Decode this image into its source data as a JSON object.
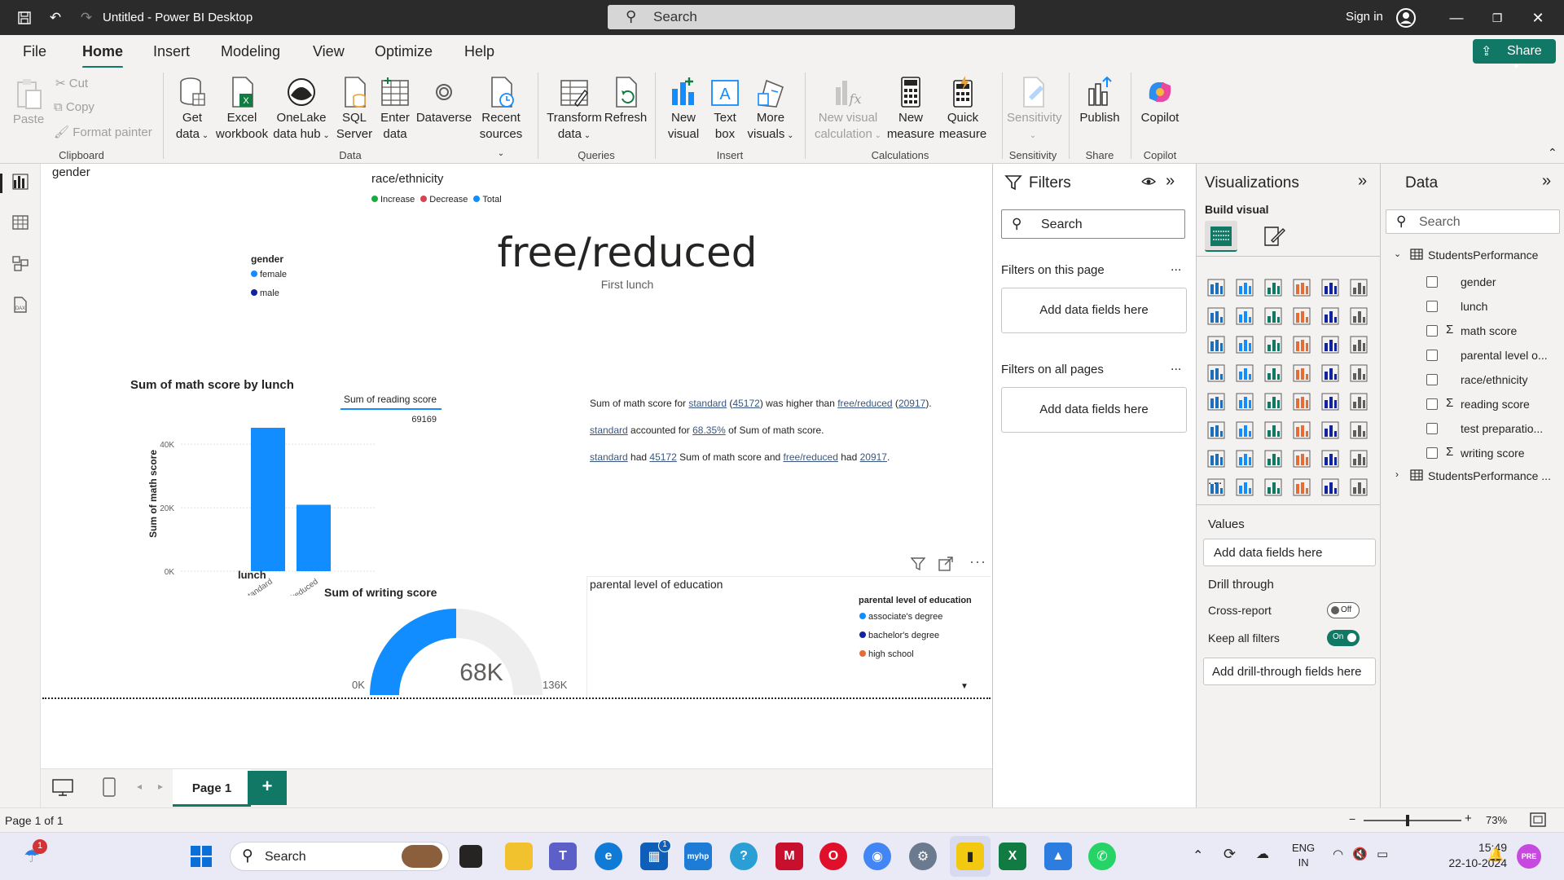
{
  "window": {
    "title": "Untitled - Power BI Desktop",
    "search_placeholder": "Search",
    "sign_in": "Sign in"
  },
  "menu": [
    "File",
    "Home",
    "Insert",
    "Modeling",
    "View",
    "Optimize",
    "Help"
  ],
  "share_label": "Share",
  "ribbon": {
    "clipboard": {
      "paste": "Paste",
      "cut": "Cut",
      "copy": "Copy",
      "format_painter": "Format painter",
      "group": "Clipboard"
    },
    "data": {
      "get_data": [
        "Get",
        "data"
      ],
      "excel": [
        "Excel",
        "workbook"
      ],
      "onelake": [
        "OneLake",
        "data hub"
      ],
      "sql": [
        "SQL",
        "Server"
      ],
      "enter": [
        "Enter",
        "data"
      ],
      "dataverse": [
        "Dataverse",
        ""
      ],
      "recent": [
        "Recent",
        "sources"
      ],
      "group": "Data"
    },
    "queries": {
      "transform": [
        "Transform",
        "data"
      ],
      "refresh": [
        "Refresh",
        ""
      ],
      "group": "Queries"
    },
    "insert": {
      "new_visual": [
        "New",
        "visual"
      ],
      "text_box": [
        "Text",
        "box"
      ],
      "more_visuals": [
        "More",
        "visuals"
      ],
      "group": "Insert"
    },
    "calculations": {
      "new_visual_calc": [
        "New visual",
        "calculation"
      ],
      "new_measure": [
        "New",
        "measure"
      ],
      "quick_measure": [
        "Quick",
        "measure"
      ],
      "group": "Calculations"
    },
    "sensitivity": {
      "label": "Sensitivity",
      "group": "Sensitivity"
    },
    "share": {
      "publish": "Publish",
      "group": "Share"
    },
    "copilot": {
      "label": "Copilot",
      "group": "Copilot"
    }
  },
  "canvas": {
    "gender_title": "gender",
    "race_title": "race/ethnicity",
    "race_legend": [
      {
        "label": "Increase",
        "color": "#1aab40"
      },
      {
        "label": "Decrease",
        "color": "#d64550"
      },
      {
        "label": "Total",
        "color": "#118dff"
      }
    ],
    "gender_legend_title": "gender",
    "gender_legend": [
      {
        "label": "female",
        "color": "#118dff"
      },
      {
        "label": "male",
        "color": "#12239e"
      }
    ],
    "card_value": "free/reduced",
    "card_label": "First lunch",
    "reading_table": {
      "header": "Sum of reading score",
      "value": "69169"
    },
    "narrative": {
      "p1": [
        "Sum of math score for ",
        "standard",
        " (",
        "45172",
        ") was higher than ",
        "free/reduced",
        " (",
        "20917",
        "). "
      ],
      "p2": [
        "standard",
        " accounted for ",
        "68.35%",
        " of Sum of math score."
      ],
      "p3": [
        "standard",
        " had ",
        "45172",
        " Sum of math score and ",
        "free/reduced",
        " had ",
        "20917",
        "."
      ]
    },
    "gauge": {
      "title": "Sum of writing score",
      "value": 68,
      "min": 0,
      "max": 136,
      "value_label": "68K",
      "min_label": "0K",
      "max_label": "136K"
    },
    "pie_title": "parental level of education",
    "pie_legend_title": "parental level of education",
    "pie_legend": [
      {
        "label": "associate's degree",
        "color": "#118dff"
      },
      {
        "label": "bachelor's degree",
        "color": "#12239e"
      },
      {
        "label": "high school",
        "color": "#e66c37"
      }
    ]
  },
  "chart_data": {
    "type": "bar",
    "title": "Sum of math score by lunch",
    "xlabel": "lunch",
    "ylabel": "Sum of math score",
    "categories": [
      "standard",
      "free/reduced"
    ],
    "values": [
      45172,
      20917
    ],
    "ylim": [
      0,
      45172
    ],
    "yticks": [
      0,
      20000,
      40000
    ],
    "ytick_labels": [
      "0K",
      "20K",
      "40K"
    ],
    "color": "#118dff",
    "grid": true
  },
  "filters": {
    "title": "Filters",
    "search_placeholder": "Search",
    "on_this_page": "Filters on this page",
    "on_all_pages": "Filters on all pages",
    "add_fields": "Add data fields here",
    "more": "..."
  },
  "visualizations": {
    "title": "Visualizations",
    "build_visual": "Build visual",
    "values": "Values",
    "add_fields": "Add data fields here",
    "drill_through": "Drill through",
    "cross_report": "Cross-report",
    "cross_report_state": "Off",
    "keep_all_filters": "Keep all filters",
    "keep_all_filters_state": "On",
    "add_drill": "Add drill-through fields here",
    "ellipsis": "..."
  },
  "data_pane": {
    "title": "Data",
    "search_placeholder": "Search",
    "table1": "StudentsPerformance",
    "fields": [
      {
        "name": "gender",
        "sigma": false
      },
      {
        "name": "lunch",
        "sigma": false
      },
      {
        "name": "math score",
        "sigma": true
      },
      {
        "name": "parental level o...",
        "sigma": false
      },
      {
        "name": "race/ethnicity",
        "sigma": false
      },
      {
        "name": "reading score",
        "sigma": true
      },
      {
        "name": "test preparatio...",
        "sigma": false
      },
      {
        "name": "writing score",
        "sigma": true
      }
    ],
    "table2": "StudentsPerformance ..."
  },
  "pages": {
    "tab": "Page 1",
    "add": "+"
  },
  "status": {
    "page": "Page 1 of 1",
    "zoom": "73%",
    "zoom_level": 0.45
  },
  "taskbar": {
    "search": "Search",
    "lang": [
      "ENG",
      "IN"
    ],
    "time": "15:49",
    "date": "22-10-2024",
    "badge_weather": "1",
    "badge_store": "1"
  }
}
